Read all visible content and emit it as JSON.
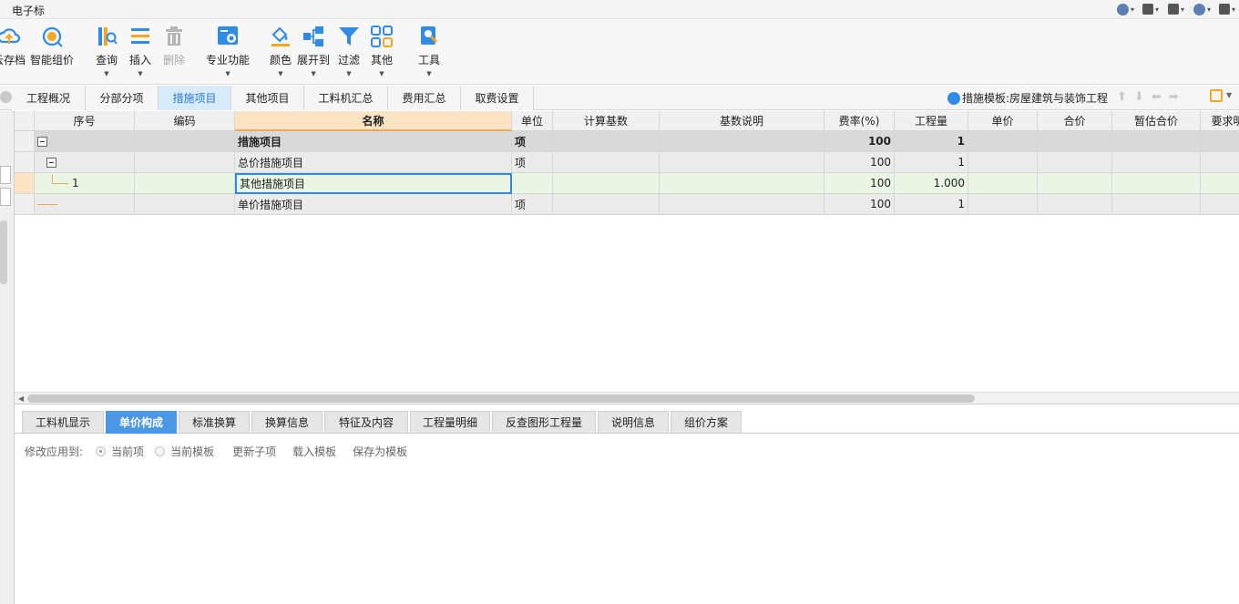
{
  "window": {
    "title": "电子标"
  },
  "ribbon": {
    "buttons": [
      {
        "label": "云存档",
        "icon": "cloud-save-icon",
        "color": "#2f8ae8",
        "dropdown": false,
        "disabled": false
      },
      {
        "label": "智能组价",
        "icon": "smart-pricing-icon",
        "color": "#f5a623",
        "dropdown": false,
        "disabled": false
      },
      {
        "label": "查询",
        "icon": "query-icon",
        "color": "#f5a623",
        "dropdown": true,
        "disabled": false
      },
      {
        "label": "插入",
        "icon": "insert-icon",
        "color": "#2f8ae8",
        "dropdown": true,
        "disabled": false
      },
      {
        "label": "删除",
        "icon": "trash-icon",
        "color": "#b5b5b5",
        "dropdown": false,
        "disabled": true
      },
      {
        "label": "专业功能",
        "icon": "professional-function-icon",
        "color": "#2f8ae8",
        "dropdown": true,
        "disabled": false
      },
      {
        "label": "颜色",
        "icon": "paint-bucket-icon",
        "color": "#f5a623",
        "dropdown": true,
        "disabled": false
      },
      {
        "label": "展开到",
        "icon": "expand-to-icon",
        "color": "#2f8ae8",
        "dropdown": true,
        "disabled": false
      },
      {
        "label": "过滤",
        "icon": "filter-icon",
        "color": "#2f8ae8",
        "dropdown": true,
        "disabled": false
      },
      {
        "label": "其他",
        "icon": "grid-apps-icon",
        "color": "#2f8ae8",
        "dropdown": true,
        "disabled": false
      },
      {
        "label": "工具",
        "icon": "tools-icon",
        "color": "#2f8ae8",
        "dropdown": true,
        "disabled": false
      }
    ]
  },
  "tabs": [
    {
      "label": "工程概况",
      "active": false
    },
    {
      "label": "分部分项",
      "active": false
    },
    {
      "label": "措施项目",
      "active": true
    },
    {
      "label": "其他项目",
      "active": false
    },
    {
      "label": "工料机汇总",
      "active": false
    },
    {
      "label": "费用汇总",
      "active": false
    },
    {
      "label": "取费设置",
      "active": false
    }
  ],
  "template_label": "措施模板:房屋建筑与装饰工程",
  "grid": {
    "columns": [
      "序号",
      "编码",
      "名称",
      "单位",
      "计算基数",
      "基数说明",
      "费率(%)",
      "工程量",
      "单价",
      "合价",
      "暂估合价",
      "要求明"
    ],
    "rows": [
      {
        "seq": "",
        "code": "",
        "name": "措施项目",
        "unit": "项",
        "base": "",
        "base_desc": "",
        "rate": "100",
        "qty": "1",
        "price": "",
        "total": "",
        "est_total": "",
        "req": "",
        "level": 0,
        "bold": true
      },
      {
        "seq": "",
        "code": "",
        "name": "总价措施项目",
        "unit": "项",
        "base": "",
        "base_desc": "",
        "rate": "100",
        "qty": "1",
        "price": "",
        "total": "",
        "est_total": "",
        "req": "",
        "level": 1,
        "bold": false
      },
      {
        "seq": "1",
        "code": "",
        "name": "其他措施项目",
        "unit": "",
        "base": "",
        "base_desc": "",
        "rate": "100",
        "qty": "1.000",
        "price": "",
        "total": "",
        "est_total": "",
        "req": "✓",
        "level": 2,
        "bold": false
      },
      {
        "seq": "",
        "code": "",
        "name": "单价措施项目",
        "unit": "项",
        "base": "",
        "base_desc": "",
        "rate": "100",
        "qty": "1",
        "price": "",
        "total": "",
        "est_total": "",
        "req": "",
        "level": 1,
        "bold": false
      }
    ]
  },
  "bottom_tabs": [
    {
      "label": "工料机显示",
      "active": false
    },
    {
      "label": "单价构成",
      "active": true
    },
    {
      "label": "标准换算",
      "active": false
    },
    {
      "label": "换算信息",
      "active": false
    },
    {
      "label": "特征及内容",
      "active": false
    },
    {
      "label": "工程量明细",
      "active": false
    },
    {
      "label": "反查图形工程量",
      "active": false
    },
    {
      "label": "说明信息",
      "active": false
    },
    {
      "label": "组价方案",
      "active": false
    }
  ],
  "options": {
    "apply_label": "修改应用到:",
    "radio_current_item": "当前项",
    "radio_current_template": "当前模板",
    "update_children": "更新子项",
    "load_template": "载入模板",
    "save_as_template": "保存为模板"
  },
  "colors": {
    "accent": "#2f8ae8",
    "orange": "#f5a623",
    "selected_row": "#eaf6e4",
    "group_row": "#d9d9d9",
    "active_bottom_tab": "#4a97e6"
  }
}
